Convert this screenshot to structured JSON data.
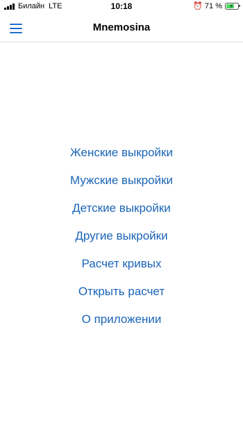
{
  "status_bar": {
    "carrier": "Билайн",
    "network": "LTE",
    "time": "10:18",
    "battery_percent": "71 %",
    "battery_level": 0.71,
    "icons": [
      "signal-icon",
      "alarm-icon",
      "battery-icon"
    ]
  },
  "nav": {
    "title": "Mnemosina",
    "menu_icon": "hamburger-menu-icon"
  },
  "menu": {
    "items": [
      {
        "label": "Женские выкройки"
      },
      {
        "label": "Мужские выкройки"
      },
      {
        "label": "Детские выкройки"
      },
      {
        "label": "Другие выкройки"
      },
      {
        "label": "Расчет кривых"
      },
      {
        "label": "Открыть расчет"
      },
      {
        "label": "О приложении"
      }
    ]
  },
  "colors": {
    "accent": "#1a64b8",
    "menu_icon": "#1e6fd0",
    "battery": "#4cd964"
  }
}
